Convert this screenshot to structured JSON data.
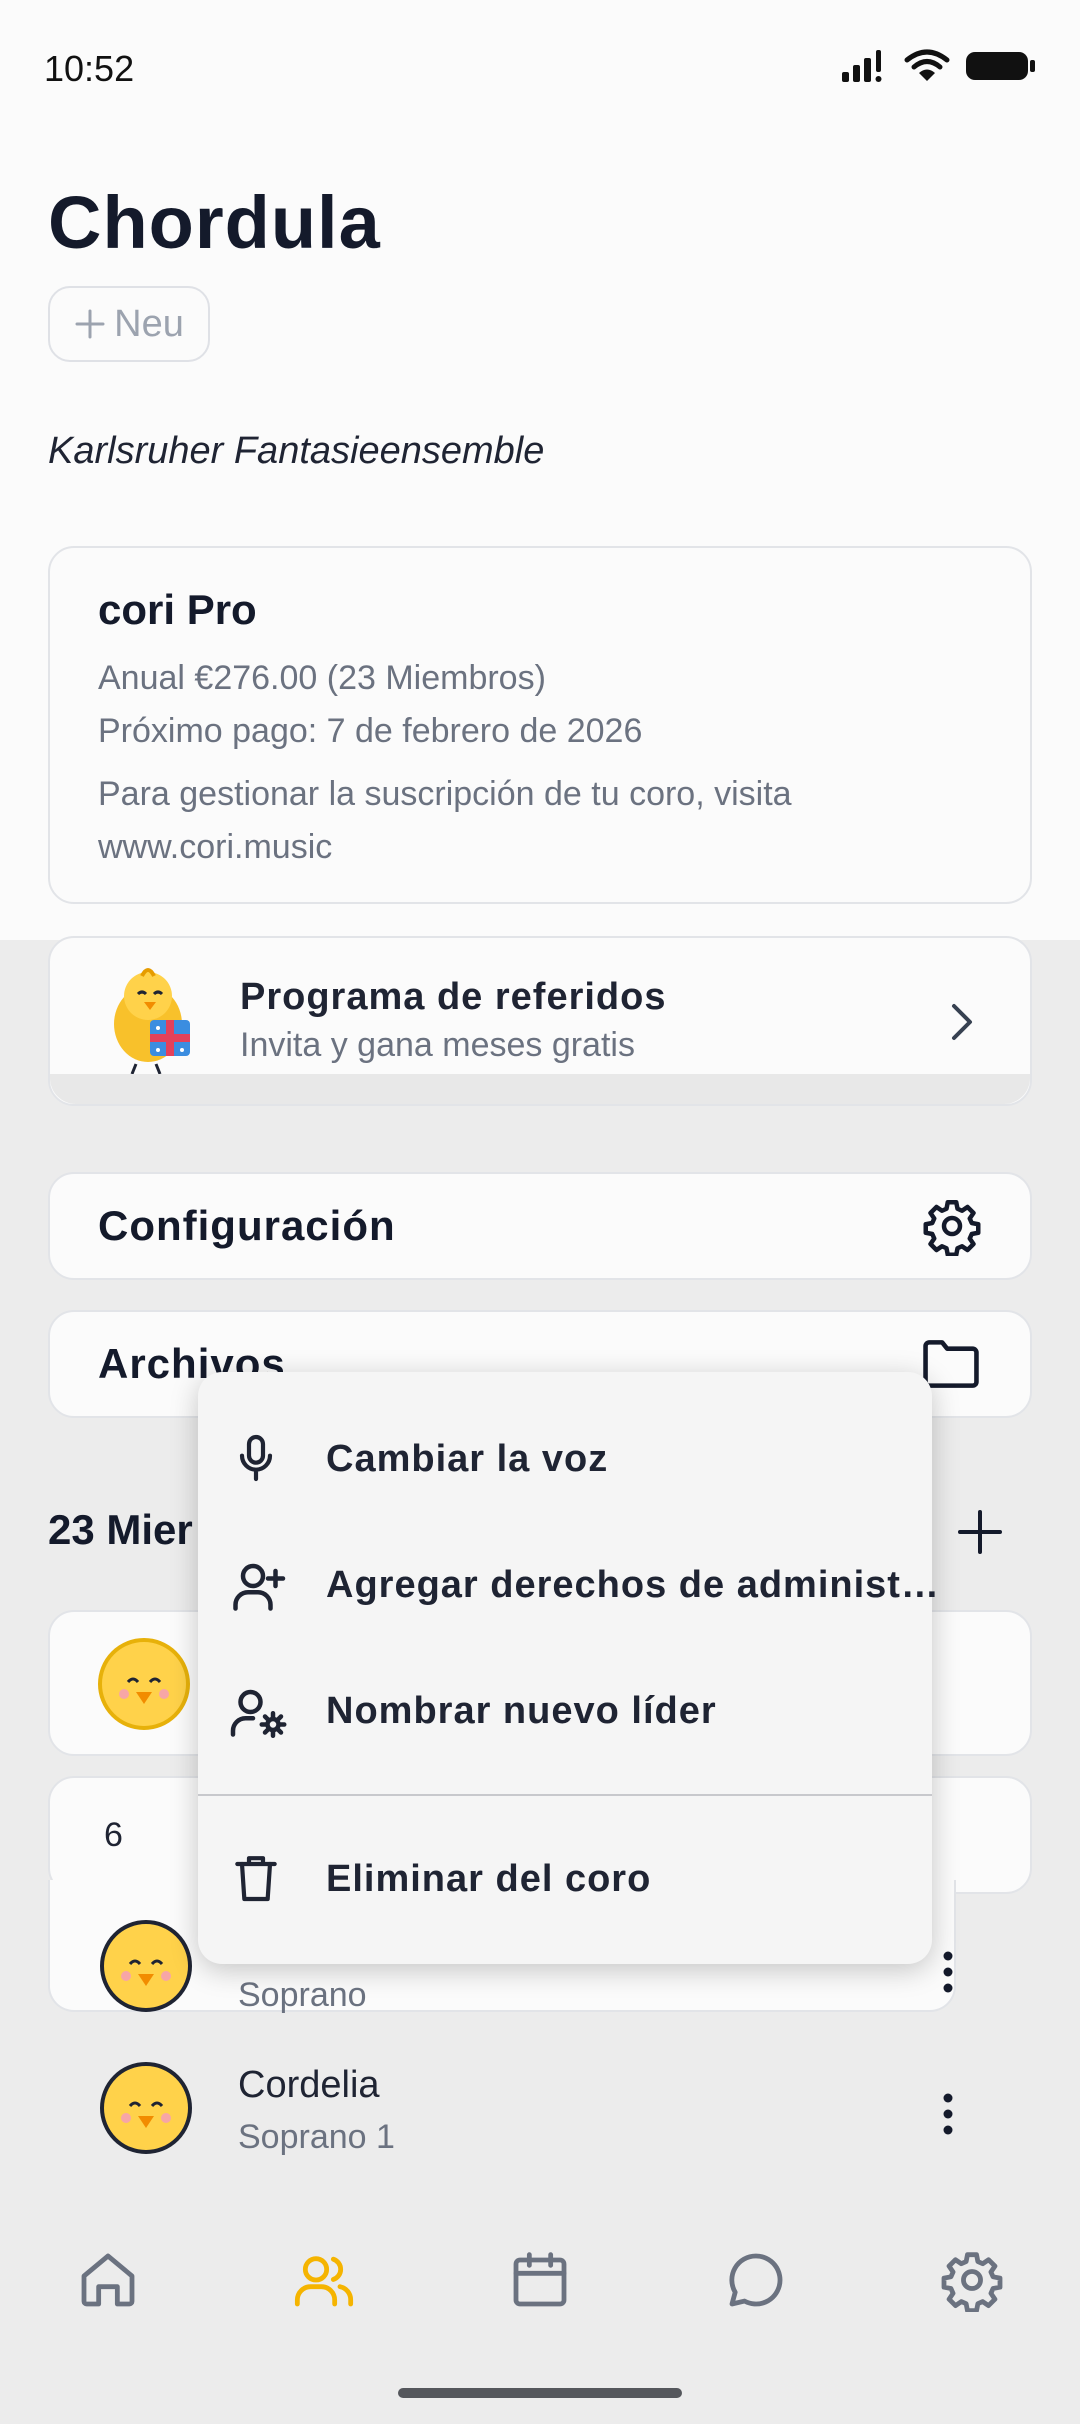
{
  "status_bar": {
    "time": "10:52"
  },
  "header": {
    "title": "Chordula",
    "new_button_label": "Neu",
    "choir_name": "Karlsruher Fantasieensemble"
  },
  "subscription": {
    "title": "cori Pro",
    "plan": "Anual €276.00 (23 Miembros)",
    "next_payment": "Próximo pago: 7 de febrero de 2026",
    "manage_text": "Para gestionar la suscripción de tu coro, visita",
    "manage_url": "www.cori.music"
  },
  "referral": {
    "title": "Programa de referidos",
    "subtitle": "Invita y gana meses gratis"
  },
  "settings_row": {
    "label": "Configuración"
  },
  "files_row": {
    "label": "Archivos"
  },
  "members": {
    "header": "23 Mier",
    "section_count": "6",
    "list": [
      {
        "name": "",
        "voice": "Soprano"
      },
      {
        "name": "Cordelia",
        "voice": "Soprano 1"
      }
    ]
  },
  "context_menu": {
    "items": [
      {
        "label": "Cambiar la voz",
        "icon": "microphone-icon"
      },
      {
        "label": "Agregar derechos de administ…",
        "icon": "user-plus-icon"
      },
      {
        "label": "Nombrar nuevo líder",
        "icon": "user-gear-icon"
      },
      {
        "label": "Eliminar del coro",
        "icon": "trash-icon"
      }
    ]
  },
  "tabbar": {
    "tabs": [
      {
        "name": "home",
        "icon": "home-icon",
        "active": false
      },
      {
        "name": "members",
        "icon": "users-icon",
        "active": true
      },
      {
        "name": "calendar",
        "icon": "calendar-icon",
        "active": false
      },
      {
        "name": "chat",
        "icon": "chat-icon",
        "active": false
      },
      {
        "name": "settings",
        "icon": "gear-icon",
        "active": false
      }
    ]
  },
  "colors": {
    "accent": "#f5b400",
    "icon_gray": "#6b7280",
    "text_dark": "#141a2b"
  }
}
